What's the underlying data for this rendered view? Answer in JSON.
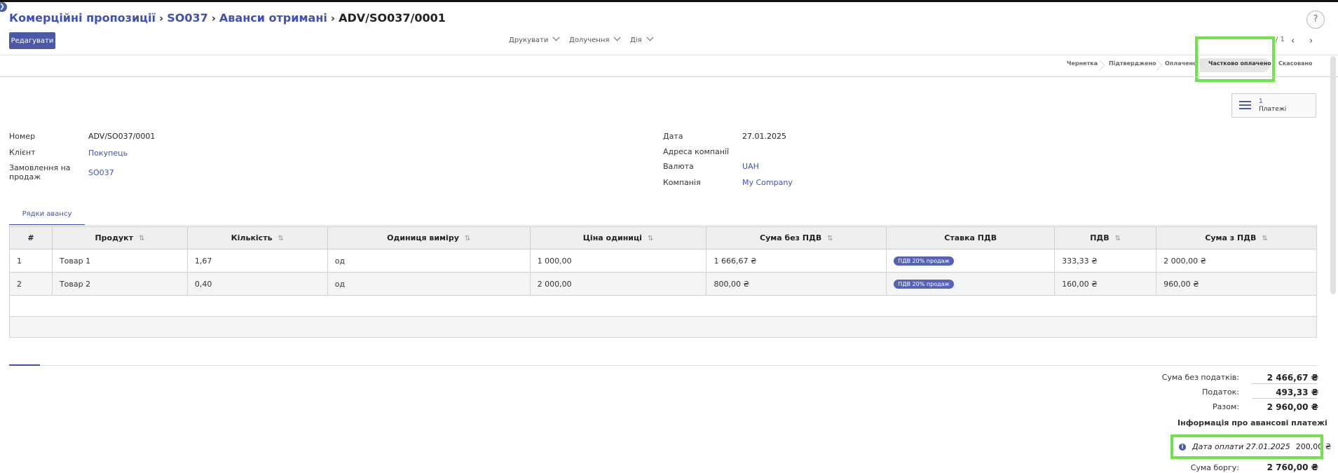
{
  "breadcrumb": {
    "items": [
      "Комерційні пропозиції",
      "SO037",
      "Аванси отримані"
    ],
    "current": "ADV/SO037/0001"
  },
  "help": "?",
  "toolbar": {
    "edit_label": "Редагувати",
    "print_label": "Друкувати",
    "attachments_label": "Долучення",
    "action_label": "Дія"
  },
  "pager": "/ 1",
  "statuses": [
    "Чернетка",
    "Підтверджено",
    "Оплачено",
    "Частково оплачено",
    "Скасовано"
  ],
  "active_status": "Частково оплачено",
  "smart_button": {
    "count": "1",
    "label": "Платежі"
  },
  "fields": {
    "number_label": "Номер",
    "number": "ADV/SO037/0001",
    "client_label": "Клієнт",
    "client": "Покупець",
    "order_label": "Замовлення на продаж",
    "order": "SO037",
    "date_label": "Дата",
    "date": "27.01.2025",
    "address_label": "Адреса компанії",
    "currency_label": "Валюта",
    "currency": "UAH",
    "company_label": "Компанія",
    "company": "My Company"
  },
  "tab_label": "Рядки авансу",
  "table": {
    "headers": [
      "#",
      "Продукт",
      "Кількість",
      "Одиниця виміру",
      "Ціна одиниці",
      "Сума без ПДВ",
      "Ставка ПДВ",
      "ПДВ",
      "Сума з ПДВ"
    ],
    "rows": [
      [
        "1",
        "Товар 1",
        "1,67",
        "од",
        "1 000,00",
        "1 666,67 ₴",
        "ПДВ 20% продаж",
        "333,33 ₴",
        "2 000,00 ₴"
      ],
      [
        "2",
        "Товар 2",
        "0,40",
        "од",
        "2 000,00",
        "800,00 ₴",
        "ПДВ 20% продаж",
        "160,00 ₴",
        "960,00 ₴"
      ]
    ]
  },
  "totals": {
    "untaxed_label": "Сума без податків:",
    "untaxed": "2 466,67 ₴",
    "tax_label": "Податок:",
    "tax": "493,33 ₴",
    "total_label": "Разом:",
    "total": "2 960,00 ₴"
  },
  "advance_info": {
    "title": "Інформація про авансові платежі",
    "payment_date_text": "Дата оплати 27.01.2025",
    "payment_amount": "200,00 ₴",
    "debt_label": "Сума боргу:",
    "debt": "2 760,00 ₴"
  },
  "colors": {
    "accent": "#3f51b5",
    "highlight": "#6fe34a",
    "badge": "#5662b8"
  }
}
